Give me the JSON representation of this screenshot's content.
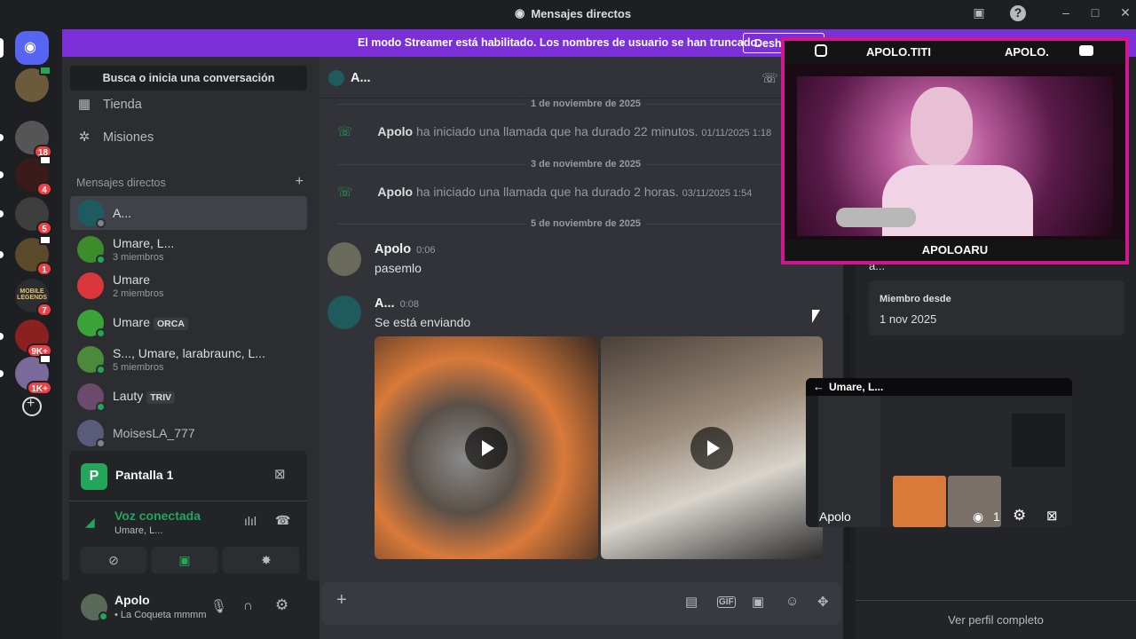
{
  "window": {
    "title": "Mensajes directos"
  },
  "banner": {
    "message": "El modo Streamer está habilitado. Los nombres de usuario se han truncado.",
    "button": "Deshabilitar"
  },
  "servers": [
    {
      "badge": "18"
    },
    {
      "badge": "4"
    },
    {
      "badge": "5"
    },
    {
      "badge": "1"
    },
    {
      "badge": "7",
      "label": "MOBILE LEGENDS"
    },
    {
      "badge": "9K+"
    },
    {
      "badge": "1K+"
    }
  ],
  "sidebar": {
    "search_label": "Busca o inicia una conversación",
    "nav": [
      {
        "label": "Tienda",
        "icon": "store-icon"
      },
      {
        "label": "Misiones",
        "icon": "quests-icon"
      }
    ],
    "dm_header": "Mensajes directos",
    "dms": [
      {
        "name": "A...",
        "sub": ""
      },
      {
        "name": "Umare, L...",
        "sub": "3 miembros"
      },
      {
        "name": "Umare",
        "sub": "2 miembros"
      },
      {
        "name": "Umare",
        "tag": "ORCA",
        "sub": ""
      },
      {
        "name": "S..., Umare, larabraunc, L...",
        "sub": "5 miembros"
      },
      {
        "name": "Lauty",
        "tag": "TRIV",
        "sub": ""
      },
      {
        "name": "MoisesLA_777",
        "sub": ""
      }
    ]
  },
  "stream_card": {
    "title": "Pantalla 1",
    "voice_status": "Voz conectada",
    "voice_channel": "Umare, L..."
  },
  "user": {
    "name": "Apolo",
    "status": "• La Coqueta mmmm"
  },
  "chat": {
    "recipient": "A...",
    "dividers": [
      "1 de noviembre de 2025",
      "3 de noviembre de 2025",
      "5 de noviembre de 2025"
    ],
    "calls": [
      {
        "author": "Apolo",
        "text": "ha iniciado una llamada que ha durado 22 minutos.",
        "time": "01/11/2025 1:18"
      },
      {
        "author": "Apolo",
        "text": "ha iniciado una llamada que ha durado 2 horas.",
        "time": "03/11/2025 1:54"
      }
    ],
    "messages": [
      {
        "author": "Apolo",
        "time": "0:06",
        "text": "pasemlo"
      },
      {
        "author": "A...",
        "time": "0:08",
        "text": "Se está enviando"
      }
    ]
  },
  "profile": {
    "name_truncated": "a...",
    "member_since_label": "Miembro desde",
    "member_since": "1 nov 2025",
    "full_profile": "Ver perfil completo"
  },
  "overlay": {
    "social_left": "APOLO.TITI",
    "social_right": "APOLO.",
    "caption": "APOLOARU",
    "brand_color": "#d2168f"
  },
  "mini_stream": {
    "title": "Umare, L...",
    "streamer": "Apolo",
    "viewers": "1"
  }
}
